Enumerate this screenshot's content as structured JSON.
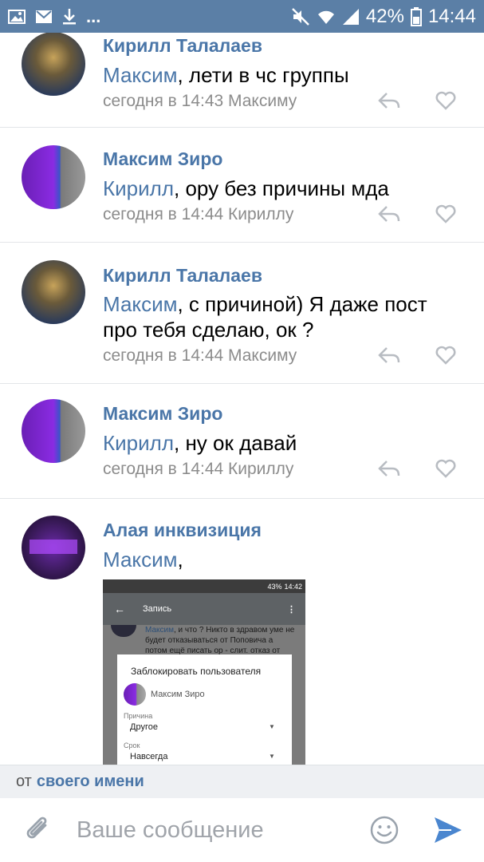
{
  "status_bar": {
    "left_icons": [
      "image-icon",
      "mail-icon",
      "download-icon"
    ],
    "dots": "...",
    "battery_percent": "42%",
    "time": "14:44"
  },
  "comments": [
    {
      "author": "Кирилл Талалаев",
      "mention": "Максим",
      "text": ", лети в чс группы",
      "meta": "сегодня в 14:43 Максиму"
    },
    {
      "author": "Максим Зиро",
      "mention": "Кирилл",
      "text": ", ору без причины мда",
      "meta": "сегодня в 14:44 Кириллу"
    },
    {
      "author": "Кирилл Талалаев",
      "mention": "Максим",
      "text": ", с причиной) Я даже пост про тебя сделаю, ок ?",
      "meta": "сегодня в 14:44 Максиму"
    },
    {
      "author": "Максим Зиро",
      "mention": "Кирилл",
      "text": ", ну ок давай",
      "meta": "сегодня в 14:44 Кириллу"
    },
    {
      "author": "Алая инквизиция",
      "mention": "Максим",
      "text": ",",
      "meta": ""
    }
  ],
  "attachment": {
    "status_bar": {
      "battery": "43%",
      "time": "14:42"
    },
    "header_title": "Запись",
    "post_mention": "Максим",
    "post_text": ", и что ? Никто в здравом уме не будет отказываться от Поповича а потом ещё писать ор - слит. отказ от",
    "dialog": {
      "title": "Заблокировать пользователя",
      "user_name": "Максим Зиро",
      "reason_label": "Причина",
      "reason_value": "Другое",
      "term_label": "Срок",
      "term_value": "Навсегда"
    }
  },
  "from_bar": {
    "prefix": "от",
    "value": "своего имени"
  },
  "input": {
    "placeholder": "Ваше сообщение"
  }
}
